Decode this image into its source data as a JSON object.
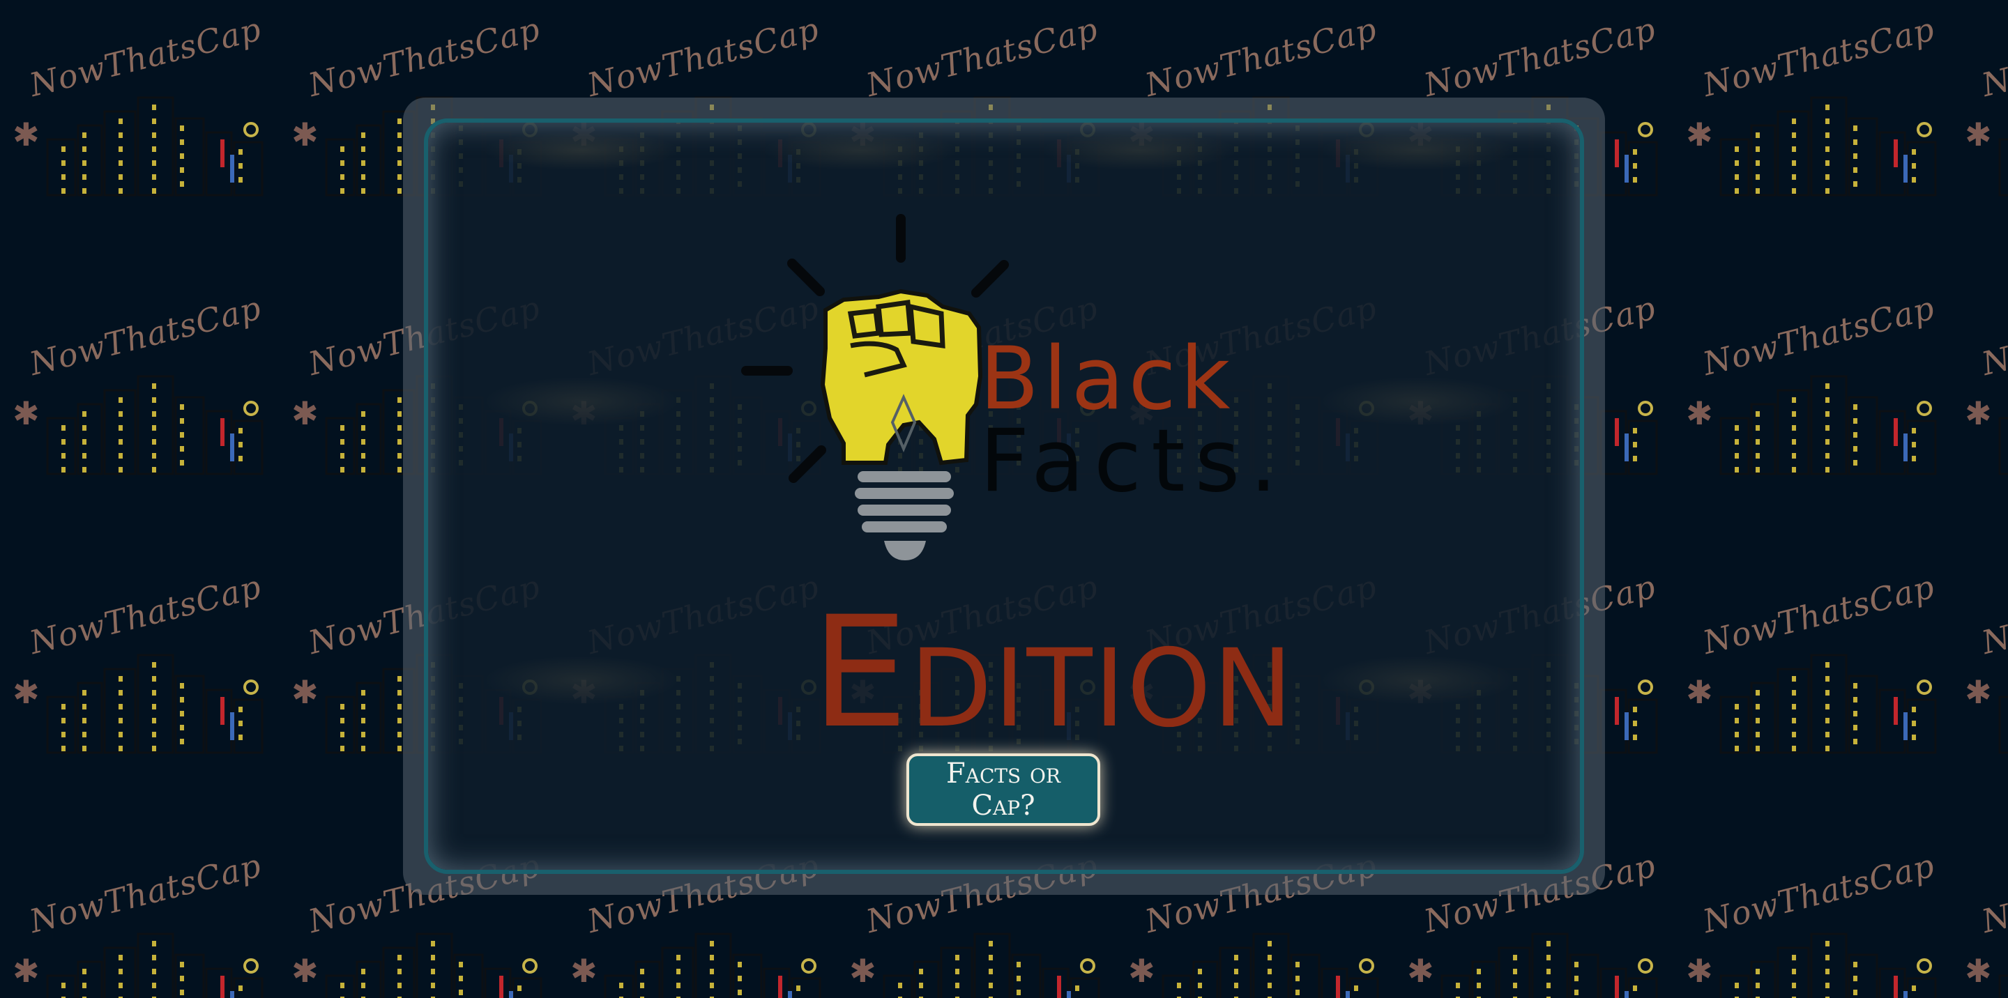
{
  "background": {
    "logo_text": "NowThatsCap",
    "icon": "city-skyline-icon"
  },
  "modal": {
    "logo": {
      "word_1": "Black",
      "word_2": "Facts.",
      "icon": "lightbulb-fist-icon"
    },
    "edition_label": "Edition",
    "cta_label": "Facts or Cap?"
  },
  "colors": {
    "background": "#02111f",
    "accent": "#19606d",
    "brand_red": "#9c3414",
    "bulb_yellow": "#e6d62c",
    "button_bg": "#155e69"
  }
}
